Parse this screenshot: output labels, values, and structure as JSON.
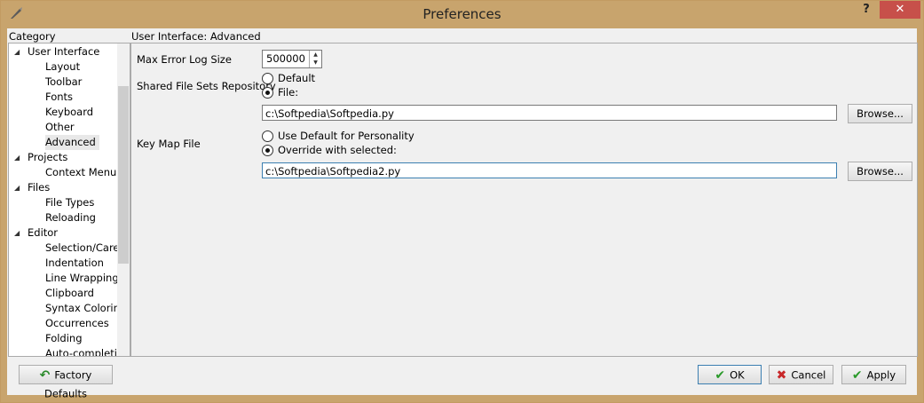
{
  "window": {
    "title": "Preferences",
    "help": "?",
    "close": "✕"
  },
  "category": {
    "label": "Category",
    "items": [
      {
        "label": "User Interface",
        "level": 0,
        "arrow": "◢"
      },
      {
        "label": "Layout",
        "level": 1
      },
      {
        "label": "Toolbar",
        "level": 1
      },
      {
        "label": "Fonts",
        "level": 1
      },
      {
        "label": "Keyboard",
        "level": 1
      },
      {
        "label": "Other",
        "level": 1
      },
      {
        "label": "Advanced",
        "level": 1,
        "selected": true
      },
      {
        "label": "Projects",
        "level": 0,
        "arrow": "◢"
      },
      {
        "label": "Context Menu",
        "level": 1
      },
      {
        "label": "Files",
        "level": 0,
        "arrow": "◢"
      },
      {
        "label": "File Types",
        "level": 1
      },
      {
        "label": "Reloading",
        "level": 1
      },
      {
        "label": "Editor",
        "level": 0,
        "arrow": "◢"
      },
      {
        "label": "Selection/Caret",
        "level": 1
      },
      {
        "label": "Indentation",
        "level": 1
      },
      {
        "label": "Line Wrapping",
        "level": 1
      },
      {
        "label": "Clipboard",
        "level": 1
      },
      {
        "label": "Syntax Coloring",
        "level": 1
      },
      {
        "label": "Occurrences",
        "level": 1
      },
      {
        "label": "Folding",
        "level": 1
      },
      {
        "label": "Auto-completion",
        "level": 1
      }
    ]
  },
  "panel": {
    "heading": "User Interface: Advanced",
    "max_error_log": {
      "label": "Max Error Log Size",
      "value": "500000",
      "up": "▲",
      "down": "▼"
    },
    "shared_repo": {
      "label": "Shared File Sets Repository",
      "opt_default": "Default",
      "opt_file": "File:",
      "path": "c:\\Softpedia\\Softpedia.py",
      "browse": "Browse..."
    },
    "key_map": {
      "label": "Key Map File",
      "opt_default": "Use Default for Personality",
      "opt_override": "Override with selected:",
      "path": "c:\\Softpedia\\Softpedia2.py",
      "browse": "Browse..."
    }
  },
  "footer": {
    "factory_defaults": "Factory Defaults",
    "ok": "OK",
    "cancel": "Cancel",
    "apply": "Apply"
  }
}
